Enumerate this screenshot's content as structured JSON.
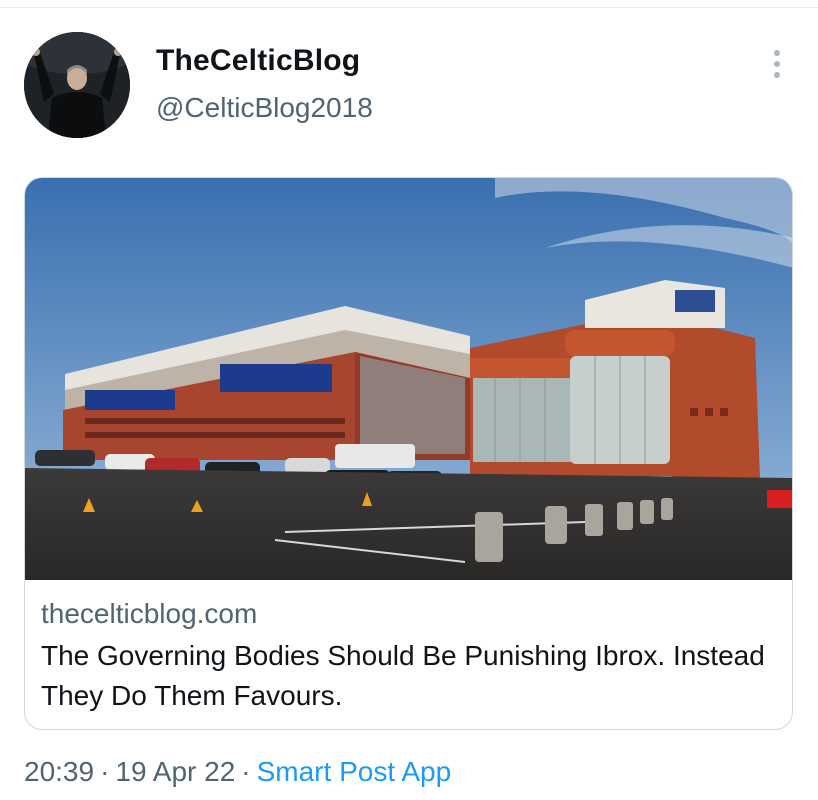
{
  "tweet": {
    "display_name": "TheCelticBlog",
    "handle": "@CelticBlog2018",
    "more_icon": "more-vertical-icon"
  },
  "card": {
    "domain": "thecelticblog.com",
    "title": "The Governing Bodies Should Be Punishing Ibrox. Instead They Do Them Favours."
  },
  "meta": {
    "time": "20:39",
    "date": "19 Apr 22",
    "separator": "·",
    "source": "Smart Post App"
  },
  "colors": {
    "link": "#1d9bf0",
    "secondary_text": "#536471",
    "border": "#cfd9de"
  }
}
